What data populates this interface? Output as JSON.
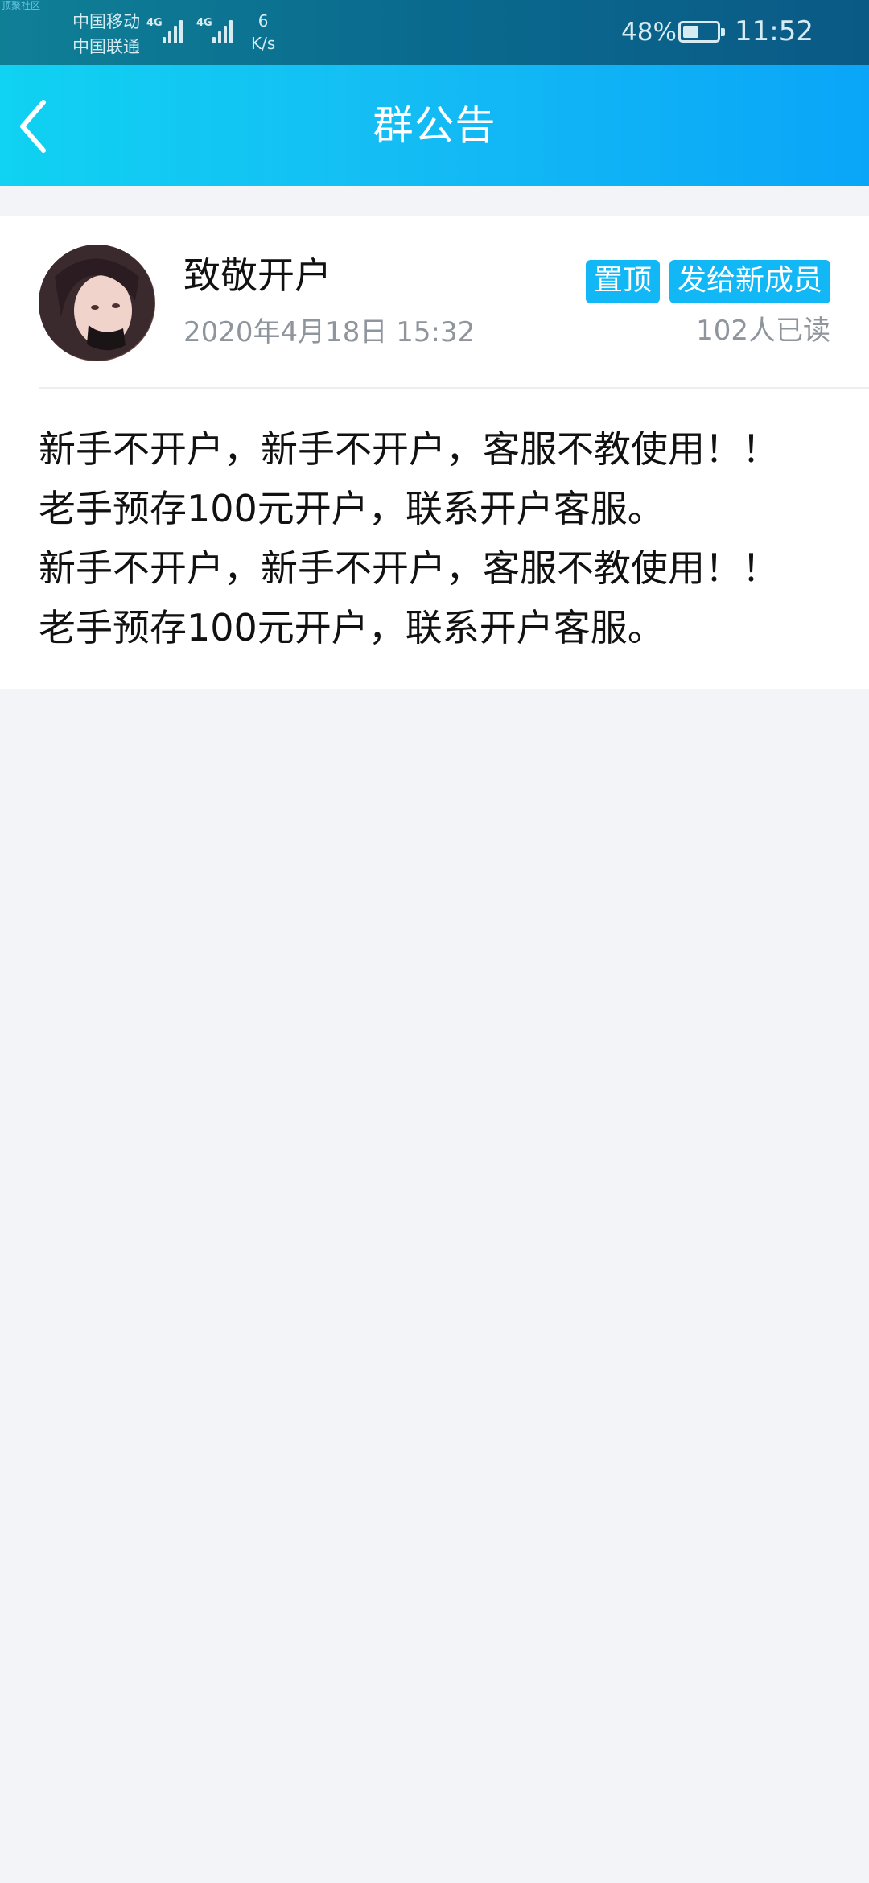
{
  "status_bar": {
    "watermark": "顶聚社区",
    "carrier_1": "中国移动",
    "carrier_2": "中国联通",
    "network_1": "4G",
    "network_2": "4G",
    "speed_value": "6",
    "speed_unit": "K/s",
    "battery_percent": "48%",
    "battery_level": 0.48,
    "time": "11:52"
  },
  "app_bar": {
    "title": "群公告",
    "back_icon": "chevron-left-icon"
  },
  "announcement": {
    "author": "致敬开户",
    "timestamp": "2020年4月18日 15:32",
    "tags": [
      "置顶",
      "发给新成员"
    ],
    "read_count": "102人已读",
    "body_lines": [
      "新手不开户，新手不开户，客服不教使用！！",
      "老手预存100元开户，联系开户客服。",
      "新手不开户，新手不开户，客服不教使用！！",
      "老手预存100元开户，联系开户客服。"
    ]
  },
  "colors": {
    "accent": "#12b7f5",
    "header_start": "#10d2f2",
    "header_end": "#0aa5f8",
    "background": "#f3f4f8"
  }
}
